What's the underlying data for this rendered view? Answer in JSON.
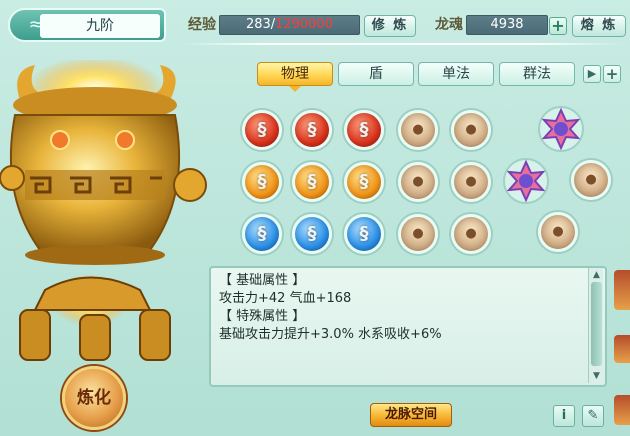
{
  "tier": {
    "name": "九阶",
    "icon": "dragon-emblem-icon"
  },
  "exp": {
    "label": "经验",
    "current": "283",
    "separator": "/",
    "max": "1290000"
  },
  "cultivate_button": "修 炼",
  "soul": {
    "label": "龙魂",
    "value": "4938"
  },
  "smelt_button": "熔 炼",
  "tabs": [
    {
      "label": "物理",
      "active": true
    },
    {
      "label": "盾",
      "active": false
    },
    {
      "label": "单法",
      "active": false
    },
    {
      "label": "群法",
      "active": false
    }
  ],
  "gem_rows": [
    [
      "red",
      "red",
      "red",
      "empty",
      "empty"
    ],
    [
      "orange",
      "orange",
      "orange",
      "empty",
      "empty"
    ],
    [
      "blue",
      "blue",
      "blue",
      "empty",
      "empty"
    ]
  ],
  "info": {
    "lines": [
      "【 基础属性 】",
      "攻击力+42 气血+168",
      "【 特殊属性 】",
      "基础攻击力提升+3.0% 水系吸收+6%"
    ]
  },
  "dragon_vein_button": "龙脉空间",
  "refine_button": "炼化",
  "colors": {
    "accent_gold": "#f6b42a",
    "exp_max": "#ff3b3b",
    "panel_teal": "#b2e0d4"
  }
}
